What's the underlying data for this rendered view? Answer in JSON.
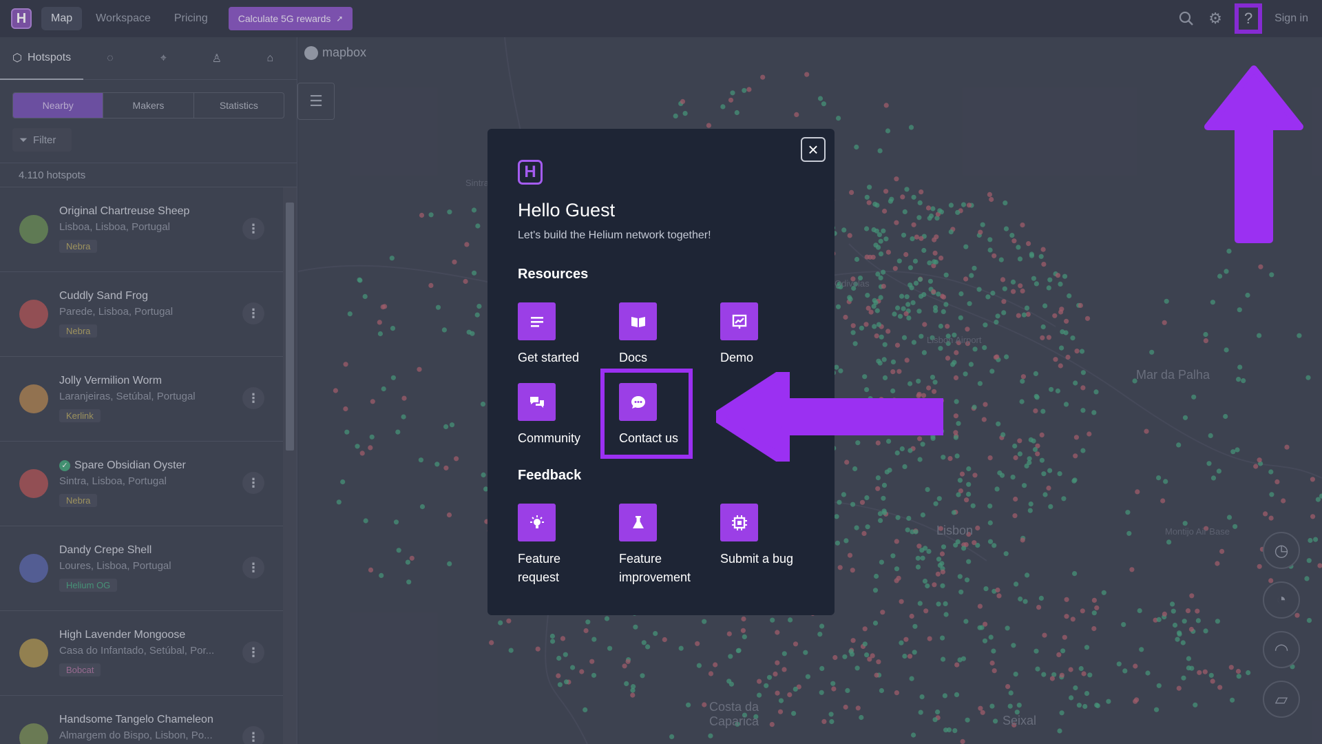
{
  "nav": {
    "logo": "H",
    "items": [
      {
        "label": "Map",
        "active": true
      },
      {
        "label": "Workspace",
        "active": false
      },
      {
        "label": "Pricing",
        "active": false
      }
    ],
    "cta_label": "Calculate 5G rewards",
    "help_label": "?",
    "signin_label": "Sign in"
  },
  "sidebar": {
    "tab_hotspots": "Hotspots",
    "segments": [
      "Nearby",
      "Makers",
      "Statistics"
    ],
    "filter_label": "Filter",
    "count_label": "4.110 hotspots",
    "items": [
      {
        "name": "Original Chartreuse Sheep",
        "location": "Lisboa, Lisboa, Portugal",
        "maker": "Nebra",
        "verified": false,
        "badge_color": "#b6a96a",
        "avatar_color": "#6d8c5e"
      },
      {
        "name": "Cuddly Sand Frog",
        "location": "Parede, Lisboa, Portugal",
        "maker": "Nebra",
        "verified": false,
        "badge_color": "#b6a96a",
        "avatar_color": "#a85a5e"
      },
      {
        "name": "Jolly Vermilion Worm",
        "location": "Laranjeiras, Setúbal, Portugal",
        "maker": "Kerlink",
        "verified": false,
        "badge_color": "#b6a96a",
        "avatar_color": "#a8835a"
      },
      {
        "name": "Spare Obsidian Oyster",
        "location": "Sintra, Lisboa, Portugal",
        "maker": "Nebra",
        "verified": true,
        "badge_color": "#b6a96a",
        "avatar_color": "#a85a5e"
      },
      {
        "name": "Dandy Crepe Shell",
        "location": "Loures, Lisboa, Portugal",
        "maker": "Helium OG",
        "verified": false,
        "badge_color": "#4fa888",
        "avatar_color": "#5e6aa8"
      },
      {
        "name": "High Lavender Mongoose",
        "location": "Casa do Infantado, Setúbal, Por...",
        "maker": "Bobcat",
        "verified": false,
        "badge_color": "#b07aa5",
        "avatar_color": "#a8935a"
      },
      {
        "name": "Handsome Tangelo Chameleon",
        "location": "Almargem do Bispo, Lisbon, Po...",
        "maker": "",
        "verified": false,
        "badge_color": "#b6a96a",
        "avatar_color": "#7a8c5e"
      }
    ]
  },
  "map": {
    "attribution": "mapbox",
    "labels": [
      "Sintra",
      "Lisbon Airport",
      "Lisbon",
      "Montijo Air Base",
      "Costa da Caparica",
      "Seixal",
      "Odivelas",
      "Mar da Palha"
    ],
    "dot_colors": [
      "#4fa888",
      "#b56a78"
    ]
  },
  "modal": {
    "logo": "H",
    "title": "Hello Guest",
    "subtitle": "Let's build the Helium network together!",
    "resources_heading": "Resources",
    "feedback_heading": "Feedback",
    "resources": [
      {
        "label": "Get started",
        "icon": "document-lines-icon"
      },
      {
        "label": "Docs",
        "icon": "open-book-icon"
      },
      {
        "label": "Demo",
        "icon": "presentation-chart-icon"
      },
      {
        "label": "Community",
        "icon": "chat-bubbles-icon"
      },
      {
        "label": "Contact us",
        "icon": "chat-dots-icon"
      }
    ],
    "feedback": [
      {
        "label": "Feature request",
        "icon": "lightbulb-icon"
      },
      {
        "label": "Feature improvement",
        "icon": "flask-icon"
      },
      {
        "label": "Submit a bug",
        "icon": "chip-icon"
      }
    ]
  },
  "annotation": {
    "color": "#9b30f2"
  }
}
